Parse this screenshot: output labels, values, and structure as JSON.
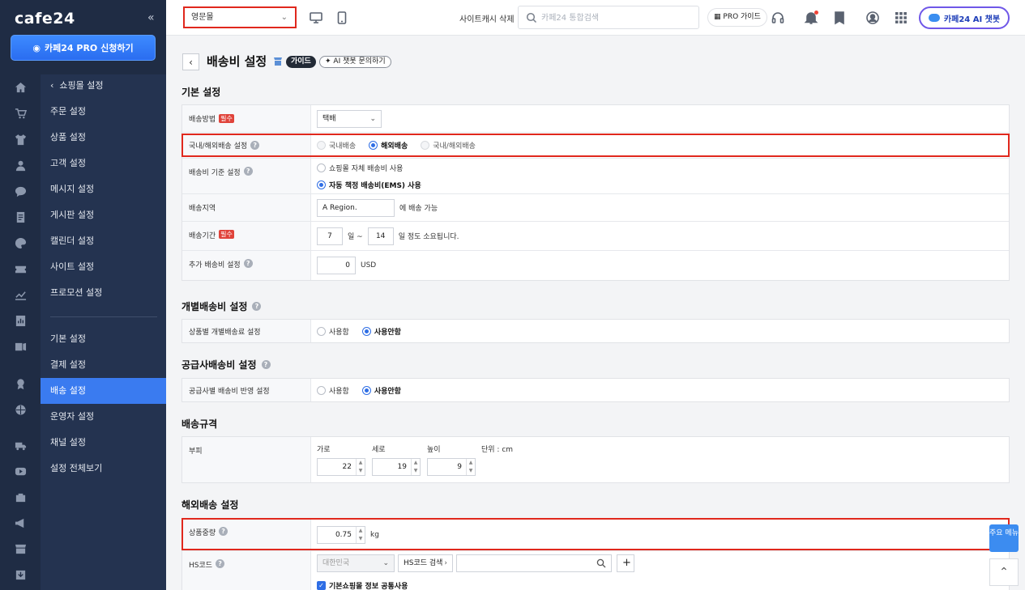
{
  "brand": {
    "logo": "cafe24"
  },
  "sidebar": {
    "collapse_label": "«",
    "pro_button": "카페24 PRO 신청하기",
    "back_label": "쇼핑몰 설정",
    "items_top": [
      "주문 설정",
      "상품 설정",
      "고객 설정",
      "메시지 설정",
      "게시판 설정",
      "캘린더 설정",
      "사이트 설정",
      "프로모션 설정"
    ],
    "items_bottom": [
      "기본 설정",
      "결제 설정",
      "배송 설정",
      "운영자 설정",
      "채널 설정",
      "설정 전체보기"
    ],
    "active": "배송 설정"
  },
  "header": {
    "mall_select": "영문몰",
    "cache_delete": "사이트캐시 삭제",
    "search_placeholder": "카페24 통합검색",
    "pro_guide": "PRO 가이드",
    "ai_chat": "카페24 AI 챗봇"
  },
  "page": {
    "title": "배송비 설정",
    "guide_badge": "가이드",
    "ai_inquiry": "AI 챗봇 문의하기"
  },
  "basic": {
    "title": "기본 설정",
    "required": "필수",
    "method_label": "배송방법",
    "method_value": "택배",
    "domestic_label": "국내/해외배송 설정",
    "domestic_opts": [
      "국내배송",
      "해외배송",
      "국내/해외배송"
    ],
    "fee_basis_label": "배송비 기준 설정",
    "fee_basis_opts": [
      "쇼핑몰 자체 배송비 사용",
      "자동 책정 배송비(EMS) 사용"
    ],
    "region_label": "배송지역",
    "region_value": "A Region.",
    "region_suffix": "에 배송 가능",
    "period_label": "배송기간",
    "period_from": "7",
    "period_mid": "일 ~",
    "period_to": "14",
    "period_suffix": "일 정도 소요됩니다.",
    "extra_label": "추가 배송비 설정",
    "extra_value": "0",
    "extra_unit": "USD"
  },
  "individual": {
    "title": "개별배송비 설정",
    "row_label": "상품별 개별배송료 설정",
    "opts": [
      "사용함",
      "사용안함"
    ]
  },
  "supplier": {
    "title": "공급사배송비 설정",
    "row_label": "공급사별 배송비 반영 설정",
    "opts": [
      "사용함",
      "사용안함"
    ]
  },
  "spec": {
    "title": "배송규격",
    "row_label": "부피",
    "w_label": "가로",
    "d_label": "세로",
    "h_label": "높이",
    "unit": "단위 : cm",
    "w": "22",
    "d": "19",
    "h": "9"
  },
  "overseas": {
    "title": "해외배송 설정",
    "weight_label": "상품중량",
    "weight_value": "0.75",
    "weight_unit": "kg",
    "hs_label": "HS코드",
    "country": "대한민국",
    "hs_search": "HS코드 검색",
    "plus": "+",
    "share_label": "기본쇼핑몰 정보 공통사용"
  },
  "float": {
    "quick_menu": "주요 메뉴",
    "top": "⌃"
  },
  "colors": {
    "accent": "#3a7bf0",
    "highlight": "#e0281d",
    "sidebar_bg": "#243350"
  }
}
